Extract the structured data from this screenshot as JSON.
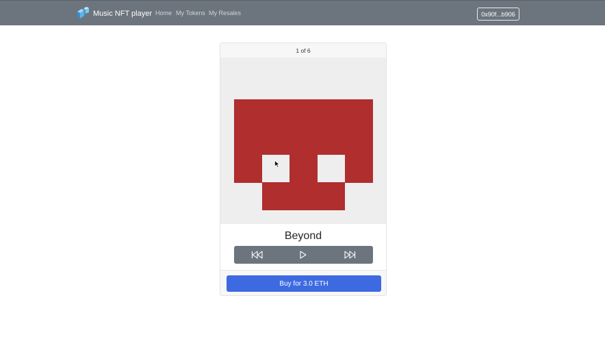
{
  "navbar": {
    "brand_label": "Music NFT player",
    "links": [
      "Home",
      "My Tokens",
      "My Resales"
    ],
    "wallet_label": "0x90f...b906"
  },
  "card": {
    "counter": "1 of 6",
    "title": "Beyond",
    "buy_label": "Buy for 3.0 ETH"
  },
  "player": {
    "controls": [
      "skip-back-icon",
      "play-icon",
      "skip-forward-icon"
    ]
  },
  "colors": {
    "navbar": "#6c757d",
    "art_red": "#b02e2e",
    "art_bg": "#eeeeee",
    "buy_button": "#3e6ae1"
  }
}
